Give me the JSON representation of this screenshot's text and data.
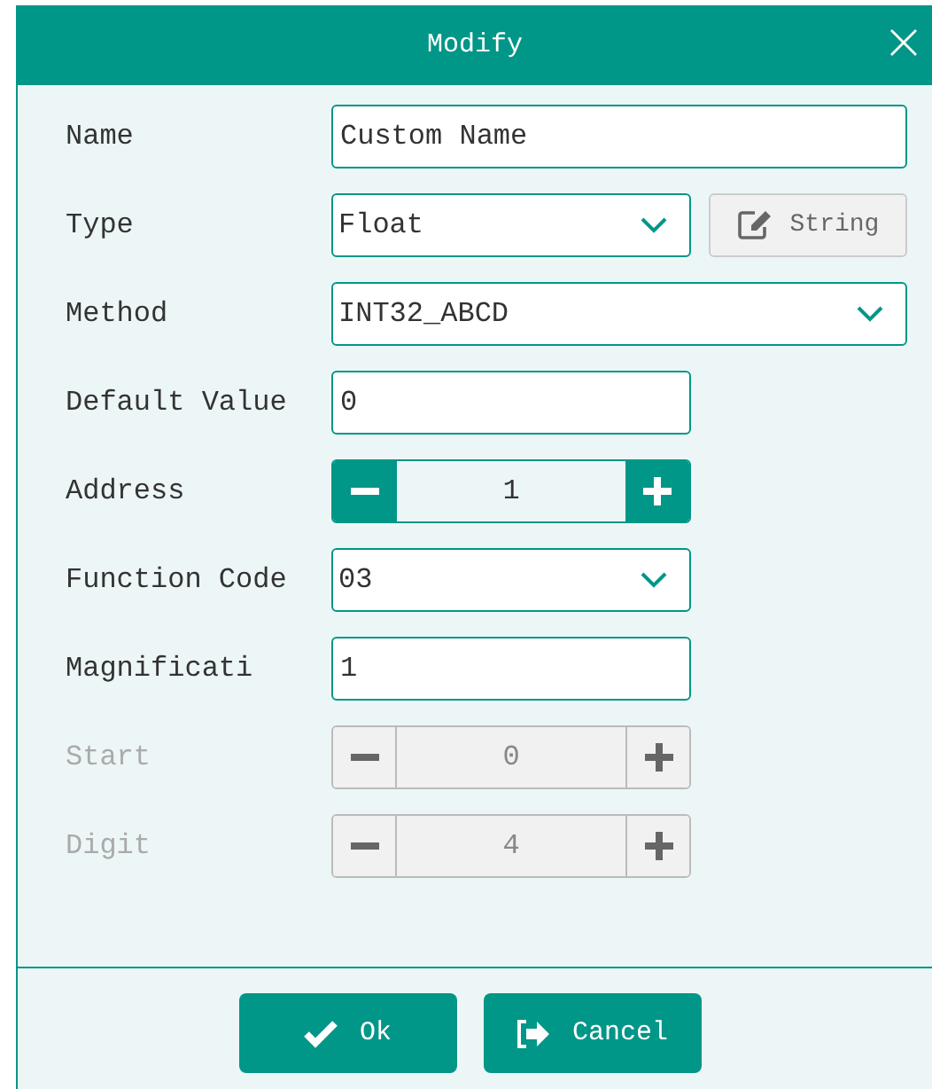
{
  "dialog": {
    "title": "Modify",
    "fields": [
      {
        "kind": "text",
        "label": "Name",
        "value": "Custom Name",
        "wide": true,
        "disabled": false
      },
      {
        "kind": "select",
        "label": "Type",
        "value": "Float",
        "wide": false,
        "disabled": false,
        "side_button": "String"
      },
      {
        "kind": "select",
        "label": "Method",
        "value": "INT32_ABCD",
        "wide": true,
        "disabled": false
      },
      {
        "kind": "text",
        "label": "Default Value",
        "value": "0",
        "wide": false,
        "disabled": false
      },
      {
        "kind": "stepper",
        "label": "Address",
        "value": "1",
        "wide": false,
        "disabled": false
      },
      {
        "kind": "select",
        "label": "Function Code",
        "value": "03",
        "wide": false,
        "disabled": false
      },
      {
        "kind": "text",
        "label": "Magnificati",
        "value": "1",
        "wide": false,
        "disabled": false
      },
      {
        "kind": "stepper",
        "label": "Start",
        "value": "0",
        "wide": false,
        "disabled": true
      },
      {
        "kind": "stepper",
        "label": "Digit",
        "value": "4",
        "wide": false,
        "disabled": true
      }
    ],
    "buttons": [
      {
        "kind": "ok",
        "label": "Ok"
      },
      {
        "kind": "cancel",
        "label": "Cancel"
      }
    ]
  }
}
